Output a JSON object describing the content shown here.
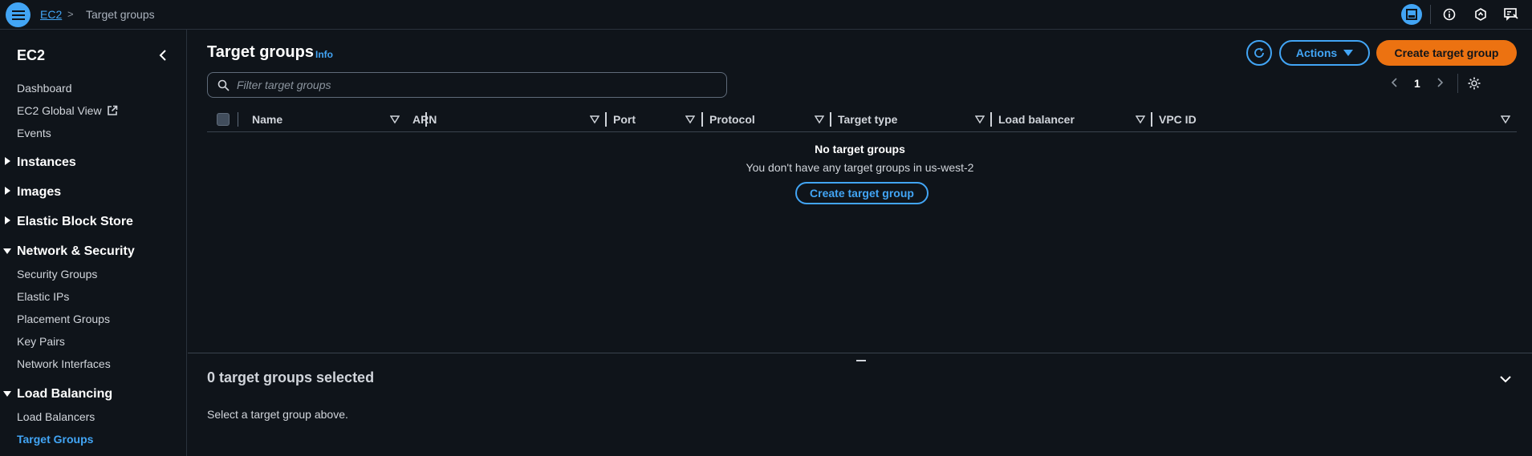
{
  "breadcrumb": {
    "root": "EC2",
    "separator": ">",
    "current": "Target groups"
  },
  "sidebar": {
    "title": "EC2",
    "top_items": [
      "Dashboard",
      "EC2 Global View",
      "Events"
    ],
    "sections": [
      {
        "label": "Instances",
        "expanded": false
      },
      {
        "label": "Images",
        "expanded": false
      },
      {
        "label": "Elastic Block Store",
        "expanded": false
      },
      {
        "label": "Network & Security",
        "expanded": true
      },
      {
        "label": "Load Balancing",
        "expanded": true
      }
    ],
    "network_items": [
      "Security Groups",
      "Elastic IPs",
      "Placement Groups",
      "Key Pairs",
      "Network Interfaces"
    ],
    "lb_items": [
      "Load Balancers",
      "Target Groups"
    ],
    "active_item": "Target Groups"
  },
  "main": {
    "title": "Target groups",
    "info": "Info",
    "actions_label": "Actions",
    "create_label": "Create target group",
    "filter_placeholder": "Filter target groups",
    "page": "1",
    "columns": [
      "Name",
      "ARN",
      "Port",
      "Protocol",
      "Target type",
      "Load balancer",
      "VPC ID"
    ],
    "empty_title": "No target groups",
    "empty_desc": "You don't have any target groups in us-west-2",
    "empty_button": "Create target group"
  },
  "split_panel": {
    "title": "0 target groups selected",
    "desc": "Select a target group above."
  },
  "colors": {
    "background": "#0f141a",
    "accent": "#42a5f5",
    "primary_button": "#ec7211"
  }
}
